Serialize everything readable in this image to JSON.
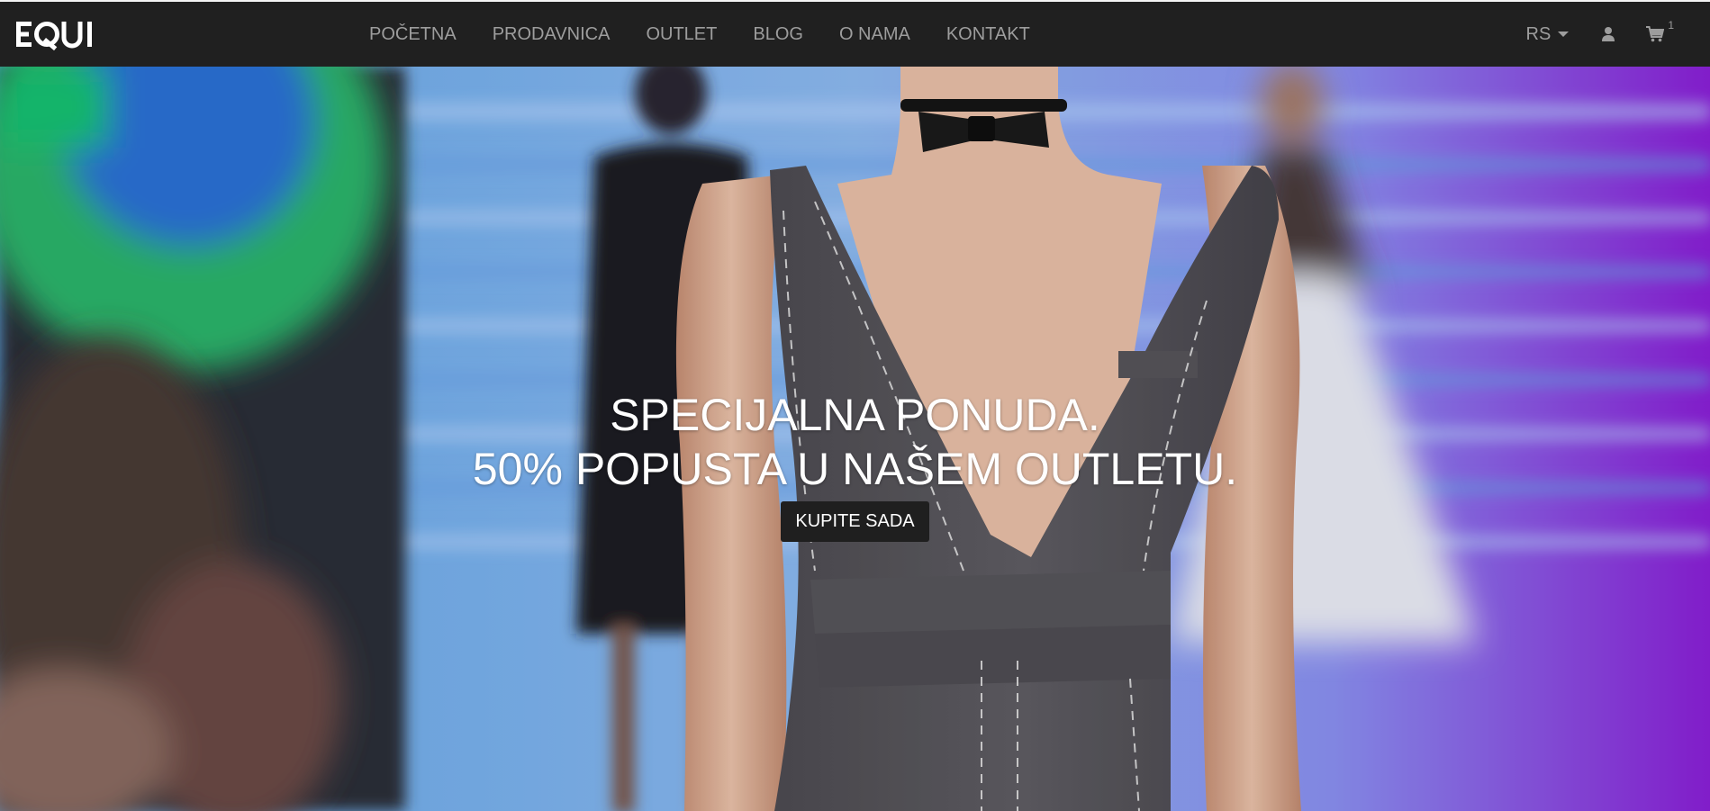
{
  "brand": {
    "logo_text": "EQUI"
  },
  "nav": {
    "items": [
      {
        "label": "POČETNA"
      },
      {
        "label": "PRODAVNICA"
      },
      {
        "label": "OUTLET"
      },
      {
        "label": "BLOG"
      },
      {
        "label": "O NAMA"
      },
      {
        "label": "KONTAKT"
      }
    ],
    "language": "RS",
    "cart_count": "1",
    "icons": [
      "caret-down-icon",
      "user-icon",
      "shopping-cart-icon"
    ]
  },
  "hero": {
    "headline_line1": "SPECIJALNA PONUDA.",
    "headline_line2": "50% POPUSTA U NAŠEM OUTLETU.",
    "cta_label": "KUPITE SADA"
  },
  "colors": {
    "navbar_bg": "#202020",
    "nav_text": "#9d9d9d",
    "hero_text": "#ffffff",
    "cta_bg": "#1f1f1f"
  }
}
